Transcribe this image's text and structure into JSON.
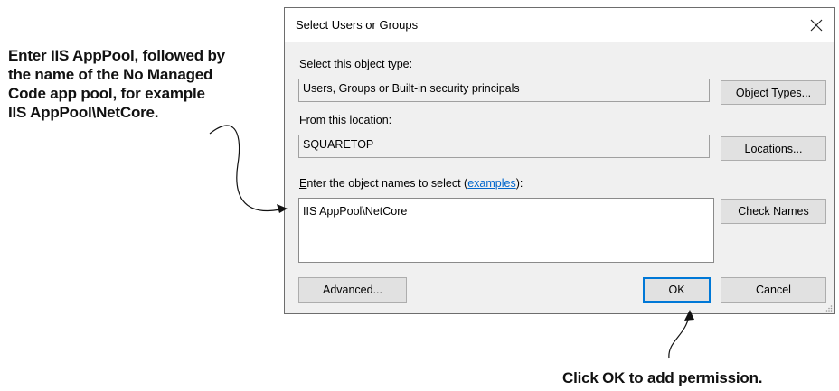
{
  "callouts": {
    "left_lines": [
      "Enter IIS AppPool, followed by",
      "the name of the No Managed",
      "Code app pool, for example",
      "IIS AppPool\\NetCore."
    ],
    "bottom": "Click OK to add permission."
  },
  "dialog": {
    "title": "Select Users or Groups",
    "close_glyph": "✕",
    "object_type": {
      "label": "Select this object type:",
      "value": "Users, Groups or Built-in security principals",
      "button": "Object Types..."
    },
    "location": {
      "label": "From this location:",
      "value": "SQUARETOP",
      "button": "Locations..."
    },
    "names": {
      "label_accel": "E",
      "label_rest": "nter the object names to select (",
      "label_link": "examples",
      "label_end": "):",
      "value": "IIS AppPool\\NetCore",
      "button": "Check Names"
    },
    "buttons": {
      "advanced": "Advanced...",
      "ok": "OK",
      "cancel": "Cancel"
    }
  },
  "colors": {
    "dialog_bg": "#f0f0f0",
    "default_button_border": "#0078d7",
    "link": "#0066cc"
  }
}
